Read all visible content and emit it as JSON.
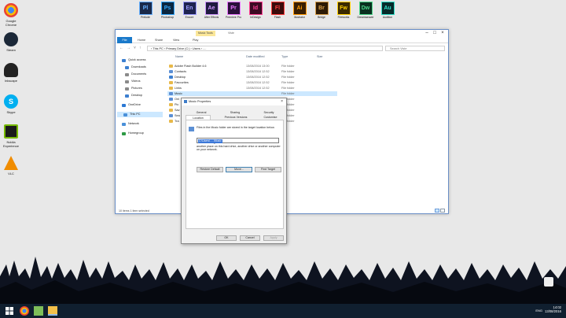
{
  "desktop_icons": [
    {
      "label": "Google Chrome",
      "icon": "chrome-icon",
      "color": "#e44d26"
    },
    {
      "label": "Steam",
      "icon": "steam-icon",
      "color": "#1b2838"
    },
    {
      "label": "Inkscape",
      "icon": "inkscape-icon",
      "color": "#333333"
    },
    {
      "label": "Skype",
      "icon": "skype-icon",
      "color": "#00aff0"
    },
    {
      "label": "Nvidia Experience",
      "icon": "nvidia-icon",
      "color": "#76b900"
    },
    {
      "label": "VLC",
      "icon": "vlc-icon",
      "color": "#f08c00"
    }
  ],
  "dock_apps": [
    {
      "abbr": "Pl",
      "label": "Prelude",
      "bg": "#1a2a4a",
      "fg": "#66b0ff"
    },
    {
      "abbr": "Ps",
      "label": "Photoshop",
      "bg": "#0b2740",
      "fg": "#31a8ff"
    },
    {
      "abbr": "En",
      "label": "Encore",
      "bg": "#1e2350",
      "fg": "#9d9dff"
    },
    {
      "abbr": "Ae",
      "label": "After Effects",
      "bg": "#1f1a3f",
      "fg": "#cf96fd"
    },
    {
      "abbr": "Pr",
      "label": "Premiere Pro",
      "bg": "#2a0f3a",
      "fg": "#ea77ff"
    },
    {
      "abbr": "Id",
      "label": "InDesign",
      "bg": "#3d0a23",
      "fg": "#ff3f94"
    },
    {
      "abbr": "Fl",
      "label": "Flash",
      "bg": "#3a0a0a",
      "fg": "#ff3b3b"
    },
    {
      "abbr": "Ai",
      "label": "Illustrator",
      "bg": "#3a1f00",
      "fg": "#ff9a00"
    },
    {
      "abbr": "Br",
      "label": "Bridge",
      "bg": "#2d1a05",
      "fg": "#d9a04a"
    },
    {
      "abbr": "Fw",
      "label": "Fireworks",
      "bg": "#3a2a00",
      "fg": "#ffd000"
    },
    {
      "abbr": "Dw",
      "label": "Dreamweaver",
      "bg": "#0a2f1f",
      "fg": "#4bd489"
    },
    {
      "abbr": "Au",
      "label": "Audition",
      "bg": "#062b2a",
      "fg": "#2ee0c9"
    }
  ],
  "explorer": {
    "tabs": {
      "music": "Music Tools",
      "file": "Viste"
    },
    "ribbon": [
      "File",
      "Home",
      "Share",
      "View",
      "Play"
    ],
    "address": "›  This PC  ›  Primary Drive (C:)  ›  Users  ›  ....",
    "search_placeholder": "Search Viste",
    "nav": [
      {
        "label": "Quick access",
        "color": "#3c7fd0"
      },
      {
        "label": "Downloads",
        "color": "#3c7fd0"
      },
      {
        "label": "Documents",
        "color": "#8a8a8a"
      },
      {
        "label": "Videos",
        "color": "#8a8a8a"
      },
      {
        "label": "Pictures",
        "color": "#8a8a8a"
      },
      {
        "label": "Desktop",
        "color": "#3c7fd0"
      },
      {
        "label": "OneDrive",
        "color": "#2b78d4"
      },
      {
        "label": "This PC",
        "color": "#4a90d9"
      },
      {
        "label": "Network",
        "color": "#4a90d9"
      },
      {
        "label": "Homegroup",
        "color": "#2e9a45"
      }
    ],
    "columns": {
      "name": "Name",
      "date": "Date modified",
      "type": "Type",
      "size": "Size"
    },
    "files": [
      {
        "name": "Adobe Flash Builder 4.6",
        "date": "13/08/2016 13:00",
        "type": "File folder"
      },
      {
        "name": "Contacts",
        "date": "13/08/2016 12:52",
        "type": "File folder"
      },
      {
        "name": "Desktop",
        "date": "13/08/2016 12:52",
        "type": "File folder"
      },
      {
        "name": "Favourites",
        "date": "13/08/2016 12:52",
        "type": "File folder"
      },
      {
        "name": "Links",
        "date": "13/08/2016 12:52",
        "type": "File folder"
      },
      {
        "name": "Music",
        "date": "",
        "type": "File folder"
      },
      {
        "name": "Onl",
        "date": "",
        "type": "File folder"
      },
      {
        "name": "Pic",
        "date": "",
        "type": "File folder"
      },
      {
        "name": "Sav",
        "date": "",
        "type": "File folder"
      },
      {
        "name": "Sea",
        "date": "",
        "type": "File folder"
      },
      {
        "name": "Tra",
        "date": "",
        "type": "File folder"
      }
    ],
    "status": "10 items     1 item selected"
  },
  "dialog": {
    "title": "Music Properties",
    "close": "×",
    "tabs_row1": [
      "General",
      "Sharing",
      "Security"
    ],
    "tabs_row2": [
      "Location",
      "Previous Versions",
      "Customise"
    ],
    "info_text": "Files in the Music folder are stored in the target location below.",
    "help_text": "You can change the location where files in this folder are stored to another place on this hard drive, another drive or another computer on your network.",
    "path_value": "C:\\Users\\.....\\Music",
    "buttons": {
      "restore": "Restore Default",
      "move": "Move...",
      "find": "Find Target",
      "ok": "OK",
      "cancel": "Cancel",
      "apply": "Apply"
    }
  },
  "taskbar": {
    "apps": [
      "start-icon",
      "chrome-icon",
      "file-explorer-icon",
      "folder-icon",
      "explorer-active-icon"
    ],
    "lang": "ENG",
    "time": "14:02",
    "date": "13/08/2016"
  }
}
